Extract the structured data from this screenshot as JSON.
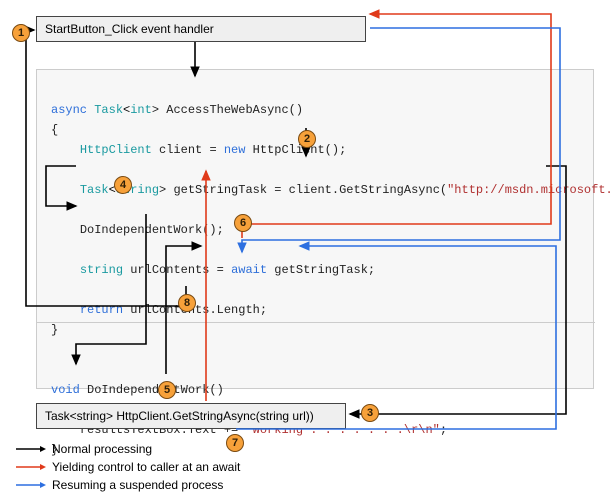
{
  "boxes": {
    "handler": "StartButton_Click event handler",
    "getStringAsync": "Task<string> HttpClient.GetStringAsync(string url))"
  },
  "code": {
    "l1_async": "async",
    "l1_tasktype": "Task",
    "l1_int": "int",
    "l1_name": "> AccessTheWebAsync()",
    "l2": "{",
    "l3_type": "HttpClient",
    "l3_rest": " client = ",
    "l3_new": "new",
    "l3_ctor": " HttpClient();",
    "l5_type": "Task",
    "l5_gen": "string",
    "l5_rest": "> getStringTask = client.GetStringAsync(",
    "l5_str": "\"http://msdn.microsoft.com\"",
    "l5_end": ");",
    "l7": "DoIndependentWork();",
    "l9_type": "string",
    "l9_mid": " urlContents = ",
    "l9_await": "await",
    "l9_end": " getStringTask;",
    "l11_ret": "return",
    "l11_end": " urlContents.Length;",
    "l12": "}",
    "l14_void": "void",
    "l14_name": " DoIndependentWork()",
    "l15": "{",
    "l16_a": "resultsTextBox.Text += ",
    "l16_str": "\"Working . . . . . . .\\r\\n\"",
    "l16_end": ";",
    "l17": "}"
  },
  "steps": {
    "s1": "1",
    "s2": "2",
    "s3": "3",
    "s4": "4",
    "s5": "5",
    "s6": "6",
    "s7": "7",
    "s8": "8"
  },
  "legend": {
    "normal": "Normal processing",
    "yield": "Yielding control to caller at an await",
    "resume": "Resuming a suspended process"
  }
}
